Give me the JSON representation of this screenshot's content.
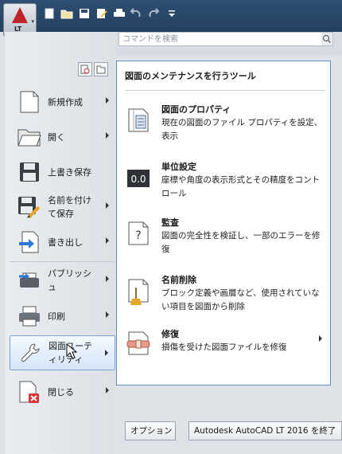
{
  "app": {
    "logo_text": "LT",
    "brand_color": "#c0232a"
  },
  "quick_access": [
    "new-icon",
    "open-icon",
    "save-icon",
    "save-as-icon",
    "print-icon",
    "undo-icon",
    "redo-icon",
    "customize-dropdown-icon"
  ],
  "search": {
    "placeholder": "コマンドを検索"
  },
  "left_menu": {
    "items": [
      {
        "label": "新規作成",
        "icon": "new-document-icon",
        "arrow": true
      },
      {
        "label": "開く",
        "icon": "open-folder-icon",
        "arrow": true
      },
      {
        "label": "上書き保存",
        "icon": "save-disk-icon",
        "arrow": false
      },
      {
        "label": "名前を付けて保存",
        "icon": "save-as-icon",
        "arrow": true
      },
      {
        "label": "書き出し",
        "icon": "export-icon",
        "arrow": true
      },
      {
        "label": "パブリッシュ",
        "icon": "publish-icon",
        "arrow": true
      },
      {
        "label": "印刷",
        "icon": "printer-icon",
        "arrow": true
      },
      {
        "label": "図面ユーティリティ",
        "icon": "wrench-icon",
        "arrow": true,
        "active": true
      },
      {
        "label": "閉じる",
        "icon": "close-document-icon",
        "arrow": true
      }
    ]
  },
  "sub_panel": {
    "title": "図面のメンテナンスを行うツール",
    "entries": [
      {
        "title": "図面のプロパティ",
        "desc": "現在の図面のファイル プロパティを設定、表示",
        "icon": "properties-icon"
      },
      {
        "title": "単位設定",
        "desc": "座標や角度の表示形式とその精度をコントロール",
        "icon": "units-icon",
        "icon_text": "0.0"
      },
      {
        "title": "監査",
        "desc": "図面の完全性を検証し、一部のエラーを修復",
        "icon": "audit-icon",
        "icon_text": "?"
      },
      {
        "title": "名前削除",
        "desc": "ブロック定義や画層など、使用されていない項目を図面から削除",
        "icon": "purge-icon"
      },
      {
        "title": "修復",
        "desc": "損傷を受けた図面ファイルを修復",
        "icon": "recover-icon",
        "arrow": true
      }
    ]
  },
  "buttons": {
    "options": "オプション",
    "exit": "Autodesk AutoCAD LT 2016 を終了"
  }
}
